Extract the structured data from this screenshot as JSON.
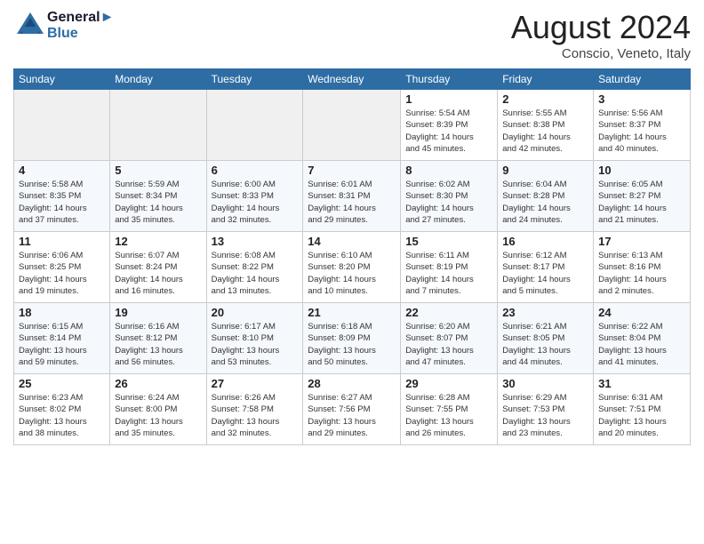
{
  "header": {
    "logo_line1": "General",
    "logo_line2": "Blue",
    "month_year": "August 2024",
    "location": "Conscio, Veneto, Italy"
  },
  "days_of_week": [
    "Sunday",
    "Monday",
    "Tuesday",
    "Wednesday",
    "Thursday",
    "Friday",
    "Saturday"
  ],
  "weeks": [
    [
      {
        "day": "",
        "info": ""
      },
      {
        "day": "",
        "info": ""
      },
      {
        "day": "",
        "info": ""
      },
      {
        "day": "",
        "info": ""
      },
      {
        "day": "1",
        "info": "Sunrise: 5:54 AM\nSunset: 8:39 PM\nDaylight: 14 hours\nand 45 minutes."
      },
      {
        "day": "2",
        "info": "Sunrise: 5:55 AM\nSunset: 8:38 PM\nDaylight: 14 hours\nand 42 minutes."
      },
      {
        "day": "3",
        "info": "Sunrise: 5:56 AM\nSunset: 8:37 PM\nDaylight: 14 hours\nand 40 minutes."
      }
    ],
    [
      {
        "day": "4",
        "info": "Sunrise: 5:58 AM\nSunset: 8:35 PM\nDaylight: 14 hours\nand 37 minutes."
      },
      {
        "day": "5",
        "info": "Sunrise: 5:59 AM\nSunset: 8:34 PM\nDaylight: 14 hours\nand 35 minutes."
      },
      {
        "day": "6",
        "info": "Sunrise: 6:00 AM\nSunset: 8:33 PM\nDaylight: 14 hours\nand 32 minutes."
      },
      {
        "day": "7",
        "info": "Sunrise: 6:01 AM\nSunset: 8:31 PM\nDaylight: 14 hours\nand 29 minutes."
      },
      {
        "day": "8",
        "info": "Sunrise: 6:02 AM\nSunset: 8:30 PM\nDaylight: 14 hours\nand 27 minutes."
      },
      {
        "day": "9",
        "info": "Sunrise: 6:04 AM\nSunset: 8:28 PM\nDaylight: 14 hours\nand 24 minutes."
      },
      {
        "day": "10",
        "info": "Sunrise: 6:05 AM\nSunset: 8:27 PM\nDaylight: 14 hours\nand 21 minutes."
      }
    ],
    [
      {
        "day": "11",
        "info": "Sunrise: 6:06 AM\nSunset: 8:25 PM\nDaylight: 14 hours\nand 19 minutes."
      },
      {
        "day": "12",
        "info": "Sunrise: 6:07 AM\nSunset: 8:24 PM\nDaylight: 14 hours\nand 16 minutes."
      },
      {
        "day": "13",
        "info": "Sunrise: 6:08 AM\nSunset: 8:22 PM\nDaylight: 14 hours\nand 13 minutes."
      },
      {
        "day": "14",
        "info": "Sunrise: 6:10 AM\nSunset: 8:20 PM\nDaylight: 14 hours\nand 10 minutes."
      },
      {
        "day": "15",
        "info": "Sunrise: 6:11 AM\nSunset: 8:19 PM\nDaylight: 14 hours\nand 7 minutes."
      },
      {
        "day": "16",
        "info": "Sunrise: 6:12 AM\nSunset: 8:17 PM\nDaylight: 14 hours\nand 5 minutes."
      },
      {
        "day": "17",
        "info": "Sunrise: 6:13 AM\nSunset: 8:16 PM\nDaylight: 14 hours\nand 2 minutes."
      }
    ],
    [
      {
        "day": "18",
        "info": "Sunrise: 6:15 AM\nSunset: 8:14 PM\nDaylight: 13 hours\nand 59 minutes."
      },
      {
        "day": "19",
        "info": "Sunrise: 6:16 AM\nSunset: 8:12 PM\nDaylight: 13 hours\nand 56 minutes."
      },
      {
        "day": "20",
        "info": "Sunrise: 6:17 AM\nSunset: 8:10 PM\nDaylight: 13 hours\nand 53 minutes."
      },
      {
        "day": "21",
        "info": "Sunrise: 6:18 AM\nSunset: 8:09 PM\nDaylight: 13 hours\nand 50 minutes."
      },
      {
        "day": "22",
        "info": "Sunrise: 6:20 AM\nSunset: 8:07 PM\nDaylight: 13 hours\nand 47 minutes."
      },
      {
        "day": "23",
        "info": "Sunrise: 6:21 AM\nSunset: 8:05 PM\nDaylight: 13 hours\nand 44 minutes."
      },
      {
        "day": "24",
        "info": "Sunrise: 6:22 AM\nSunset: 8:04 PM\nDaylight: 13 hours\nand 41 minutes."
      }
    ],
    [
      {
        "day": "25",
        "info": "Sunrise: 6:23 AM\nSunset: 8:02 PM\nDaylight: 13 hours\nand 38 minutes."
      },
      {
        "day": "26",
        "info": "Sunrise: 6:24 AM\nSunset: 8:00 PM\nDaylight: 13 hours\nand 35 minutes."
      },
      {
        "day": "27",
        "info": "Sunrise: 6:26 AM\nSunset: 7:58 PM\nDaylight: 13 hours\nand 32 minutes."
      },
      {
        "day": "28",
        "info": "Sunrise: 6:27 AM\nSunset: 7:56 PM\nDaylight: 13 hours\nand 29 minutes."
      },
      {
        "day": "29",
        "info": "Sunrise: 6:28 AM\nSunset: 7:55 PM\nDaylight: 13 hours\nand 26 minutes."
      },
      {
        "day": "30",
        "info": "Sunrise: 6:29 AM\nSunset: 7:53 PM\nDaylight: 13 hours\nand 23 minutes."
      },
      {
        "day": "31",
        "info": "Sunrise: 6:31 AM\nSunset: 7:51 PM\nDaylight: 13 hours\nand 20 minutes."
      }
    ]
  ]
}
